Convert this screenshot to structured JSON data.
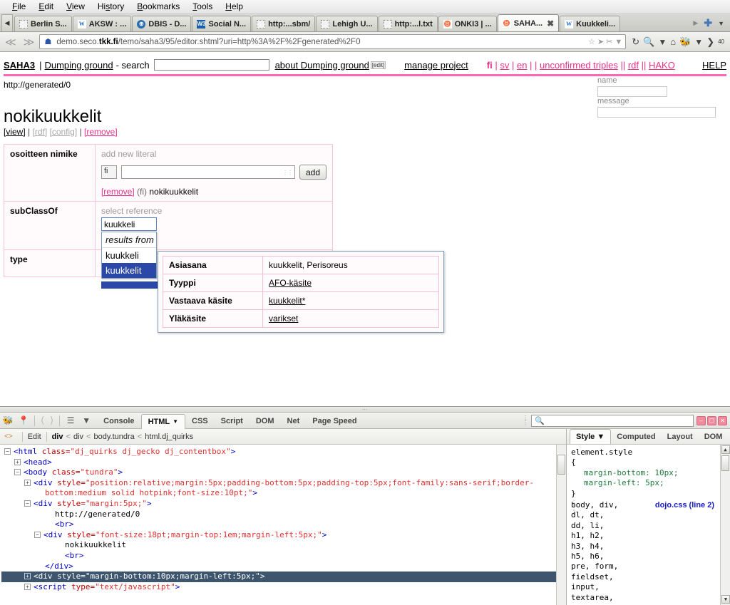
{
  "browser": {
    "menu": [
      "File",
      "Edit",
      "View",
      "History",
      "Bookmarks",
      "Tools",
      "Help"
    ],
    "tabs": [
      {
        "label": "Berlin S...",
        "icon": "blank-favicon",
        "active": false
      },
      {
        "label": "AKSW : ...",
        "icon": "wikipedia-favicon",
        "active": false
      },
      {
        "label": "DBIS - D...",
        "icon": "globe-favicon",
        "active": false
      },
      {
        "label": "Social N...",
        "icon": "w3c-favicon",
        "active": false
      },
      {
        "label": "http:...sbm/",
        "icon": "blank-favicon",
        "active": false
      },
      {
        "label": "Lehigh U...",
        "icon": "blank-favicon",
        "active": false
      },
      {
        "label": "http:...l.txt",
        "icon": "blank-favicon",
        "active": false
      },
      {
        "label": "ONKI3 | ...",
        "icon": "seco-favicon",
        "active": false
      },
      {
        "label": "SAHA...",
        "icon": "seco-favicon",
        "active": true
      },
      {
        "label": "Kuukkeli...",
        "icon": "wikipedia-favicon",
        "active": false
      }
    ],
    "url_prefix": "demo.seco.",
    "url_domain": "tkk.fi",
    "url_suffix": "/temo/saha3/95/editor.shtml?uri=http%3A%2F%2Fgenerated%2F0",
    "zoom_badge": "40"
  },
  "saha": {
    "logo": "SAHA3",
    "sep": "|",
    "project": "Dumping ground",
    "search_label": "- search",
    "search_value": "",
    "about": "about Dumping ground",
    "about_edit": "[edit]",
    "manage": "manage project",
    "langs": [
      "fi",
      "sv",
      "en"
    ],
    "unconfirmed": "unconfirmed triples",
    "rdf": "rdf",
    "hako": "HAKO",
    "help": "HELP",
    "accent_color": "#e8308a",
    "border_color": "hotpink"
  },
  "resource": {
    "uri": "http://generated/0",
    "title": "nokikuukkelit",
    "actions": [
      {
        "label": "[view]",
        "style": "active"
      },
      {
        "label": "[rdf]",
        "style": "disabled"
      },
      {
        "label": "[config]",
        "style": "disabled"
      },
      {
        "label": "[remove]",
        "style": "remove"
      }
    ],
    "properties": [
      {
        "name": "osoitteen nimike",
        "kind": "literal",
        "hint": "add new literal",
        "lang": "fi",
        "input_value": "",
        "add_label": "add",
        "values": [
          {
            "remove": "[remove]",
            "lang": "(fi)",
            "text": "nokikuukkelit"
          }
        ]
      },
      {
        "name": "subClassOf",
        "kind": "reference",
        "hint": "select reference",
        "autocomplete": {
          "value": "kuukkeli",
          "results_header": "results from",
          "items": [
            {
              "label": "kuukkeli",
              "selected": false
            },
            {
              "label": "kuukkelit",
              "selected": true
            }
          ]
        }
      },
      {
        "name": "type",
        "kind": "reference",
        "hint": "",
        "values": []
      }
    ]
  },
  "concept_popup": {
    "rows": [
      {
        "key": "Asiasana",
        "value": "kuukkelit, Perisoreus",
        "link": false
      },
      {
        "key": "Tyyppi",
        "value": "AFO-käsite",
        "link": true
      },
      {
        "key": "Vastaava käsite",
        "value": "kuukkelit*",
        "link": true
      },
      {
        "key": "Yläkäsite",
        "value": "varikset",
        "link": true
      }
    ]
  },
  "side_form": {
    "name_label": "name",
    "name_value": "",
    "message_label": "message",
    "message_value": ""
  },
  "firebug": {
    "tabs": [
      "Console",
      "HTML",
      "CSS",
      "Script",
      "DOM",
      "Net",
      "Page Speed"
    ],
    "active_tab": "HTML",
    "search_placeholder": "",
    "win_buttons": [
      "minimize",
      "maximize",
      "close"
    ],
    "breadcrumb": {
      "edit_label": "Edit",
      "path": [
        "div",
        "div",
        "body.tundra",
        "html.dj_quirks"
      ],
      "separator": "<"
    },
    "html_lines": [
      {
        "indent": 0,
        "twisty": "−",
        "parts": [
          {
            "t": "tw",
            "s": "<html "
          },
          {
            "t": "at",
            "s": "class="
          },
          {
            "t": "av",
            "s": "\"dj_quirks dj_gecko dj_contentbox\""
          },
          {
            "t": "tw",
            "s": ">"
          }
        ]
      },
      {
        "indent": 1,
        "twisty": "+",
        "parts": [
          {
            "t": "tw",
            "s": "<head>"
          }
        ]
      },
      {
        "indent": 1,
        "twisty": "−",
        "parts": [
          {
            "t": "tw",
            "s": "<body "
          },
          {
            "t": "at",
            "s": "class="
          },
          {
            "t": "av",
            "s": "\"tundra\""
          },
          {
            "t": "tw",
            "s": ">"
          }
        ]
      },
      {
        "indent": 2,
        "twisty": "+",
        "parts": [
          {
            "t": "tw",
            "s": "<div "
          },
          {
            "t": "at",
            "s": "style="
          },
          {
            "t": "av",
            "s": "\"position:relative;margin:5px;padding-bottom:5px;padding-top:5px;font-family:sans-serif;border-"
          }
        ]
      },
      {
        "indent": 3,
        "twisty": "",
        "parts": [
          {
            "t": "av",
            "s": "bottom:medium solid hotpink;font-size:10pt;\""
          },
          {
            "t": "tw",
            "s": ">"
          }
        ]
      },
      {
        "indent": 2,
        "twisty": "−",
        "parts": [
          {
            "t": "tw",
            "s": "<div "
          },
          {
            "t": "at",
            "s": "style="
          },
          {
            "t": "av",
            "s": "\"margin:5px;\""
          },
          {
            "t": "tw",
            "s": ">"
          }
        ]
      },
      {
        "indent": 4,
        "twisty": "",
        "parts": [
          {
            "t": "tx",
            "s": "http://generated/0"
          }
        ]
      },
      {
        "indent": 4,
        "twisty": "",
        "parts": [
          {
            "t": "tw",
            "s": "<br>"
          }
        ]
      },
      {
        "indent": 3,
        "twisty": "−",
        "parts": [
          {
            "t": "tw",
            "s": "<div "
          },
          {
            "t": "at",
            "s": "style="
          },
          {
            "t": "av",
            "s": "\"font-size:18pt;margin-top:1em;margin-left:5px;\""
          },
          {
            "t": "tw",
            "s": ">"
          }
        ]
      },
      {
        "indent": 5,
        "twisty": "",
        "parts": [
          {
            "t": "tx",
            "s": "nokikuukkelit"
          }
        ]
      },
      {
        "indent": 5,
        "twisty": "",
        "parts": [
          {
            "t": "tw",
            "s": "<br>"
          }
        ]
      },
      {
        "indent": 3,
        "twisty": "",
        "parts": [
          {
            "t": "tw",
            "s": "</div>"
          }
        ]
      },
      {
        "indent": 2,
        "twisty": "+",
        "selected": true,
        "parts": [
          {
            "t": "tw",
            "s": "<div "
          },
          {
            "t": "at",
            "s": "style="
          },
          {
            "t": "av",
            "s": "\"margin-bottom:10px;margin-left:5px;\""
          },
          {
            "t": "tw",
            "s": ">"
          }
        ]
      },
      {
        "indent": 2,
        "twisty": "+",
        "parts": [
          {
            "t": "tw",
            "s": "<script "
          },
          {
            "t": "at",
            "s": "type="
          },
          {
            "t": "av",
            "s": "\"text/javascript\""
          },
          {
            "t": "tw",
            "s": ">"
          }
        ]
      }
    ],
    "style_tabs": [
      "Style",
      "Computed",
      "Layout",
      "DOM"
    ],
    "active_style_tab": "Style",
    "css_rules": [
      {
        "selector": "element.style",
        "source": "",
        "open": "{",
        "decls": [
          {
            "prop": "margin-bottom:",
            "value": "10px;"
          },
          {
            "prop": "margin-left:",
            "value": "5px;"
          }
        ],
        "close": "}"
      },
      {
        "selector_lines": [
          "body, div,",
          "dl, dt,",
          "dd, li,",
          "h1, h2,",
          "h3, h4,",
          "h5, h6,",
          "pre, form,",
          "fieldset,",
          "input,",
          "textarea,"
        ],
        "source": "dojo.css (line 2)"
      }
    ]
  }
}
